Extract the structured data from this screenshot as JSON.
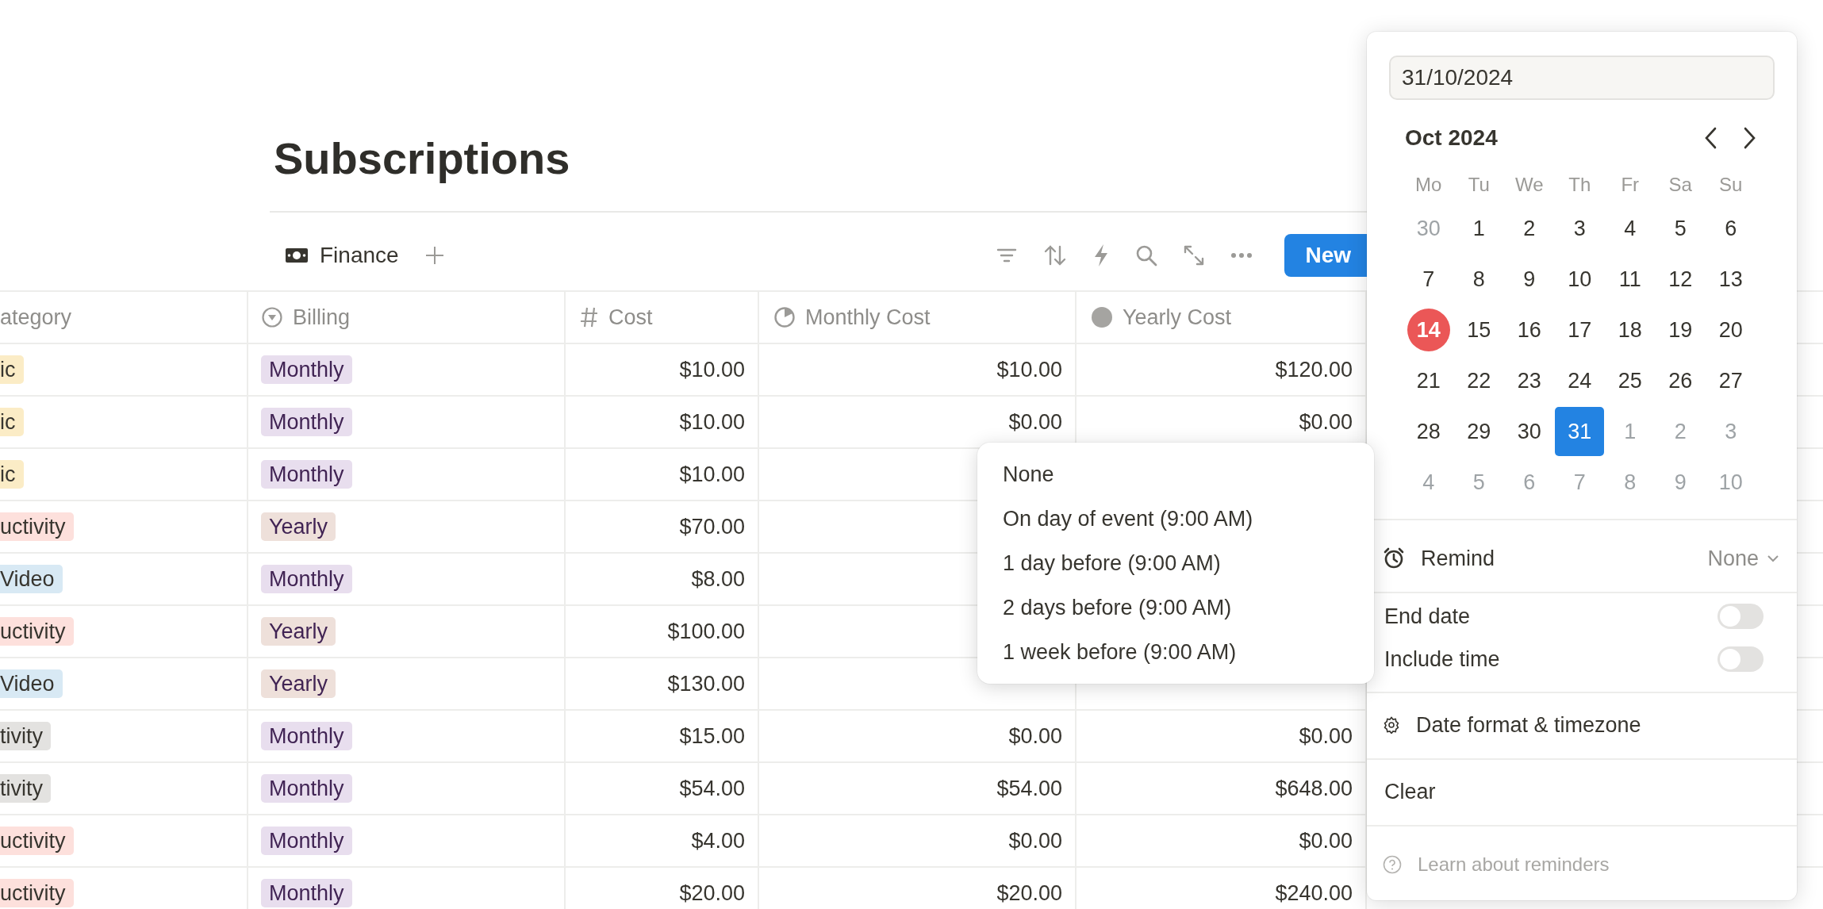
{
  "page": {
    "title": "Subscriptions"
  },
  "view_tabs": [
    {
      "label": "Finance",
      "selected": true
    }
  ],
  "toolbar": {
    "new_button": "New"
  },
  "table": {
    "columns": [
      {
        "label": "ategory",
        "kind": "none"
      },
      {
        "label": "Billing",
        "kind": "select"
      },
      {
        "label": "Cost",
        "kind": "number"
      },
      {
        "label": "Monthly Cost",
        "kind": "formula"
      },
      {
        "label": "Yearly Cost",
        "kind": "rollup"
      }
    ],
    "rows": [
      {
        "category": {
          "label": "ic",
          "color": "#fbecc6"
        },
        "billing": {
          "label": "Monthly",
          "color": "#e8deee"
        },
        "cost": "$10.00",
        "monthly_cost": "$10.00",
        "yearly_cost": "$120.00"
      },
      {
        "category": {
          "label": "ic",
          "color": "#fbecc6"
        },
        "billing": {
          "label": "Monthly",
          "color": "#e8deee"
        },
        "cost": "$10.00",
        "monthly_cost": "$0.00",
        "yearly_cost": "$0.00"
      },
      {
        "category": {
          "label": "ic",
          "color": "#fbecc6"
        },
        "billing": {
          "label": "Monthly",
          "color": "#e8deee"
        },
        "cost": "$10.00"
      },
      {
        "category": {
          "label": "uctivity",
          "color": "#fde0dc"
        },
        "billing": {
          "label": "Yearly",
          "color": "#eee0da"
        },
        "cost": "$70.00"
      },
      {
        "category": {
          "label": "Video",
          "color": "#d8e9f4"
        },
        "billing": {
          "label": "Monthly",
          "color": "#e8deee"
        },
        "cost": "$8.00"
      },
      {
        "category": {
          "label": "uctivity",
          "color": "#fde0dc"
        },
        "billing": {
          "label": "Yearly",
          "color": "#eee0da"
        },
        "cost": "$100.00"
      },
      {
        "category": {
          "label": "Video",
          "color": "#d8e9f4"
        },
        "billing": {
          "label": "Yearly",
          "color": "#eee0da"
        },
        "cost": "$130.00"
      },
      {
        "category": {
          "label": "tivity",
          "color": "#e3e2e0"
        },
        "billing": {
          "label": "Monthly",
          "color": "#e8deee"
        },
        "cost": "$15.00",
        "monthly_cost": "$0.00",
        "yearly_cost": "$0.00"
      },
      {
        "category": {
          "label": "tivity",
          "color": "#e3e2e0"
        },
        "billing": {
          "label": "Monthly",
          "color": "#e8deee"
        },
        "cost": "$54.00",
        "monthly_cost": "$54.00",
        "yearly_cost": "$648.00"
      },
      {
        "category": {
          "label": "uctivity",
          "color": "#fde0dc"
        },
        "billing": {
          "label": "Monthly",
          "color": "#e8deee"
        },
        "cost": "$4.00",
        "monthly_cost": "$0.00",
        "yearly_cost": "$0.00"
      },
      {
        "category": {
          "label": "uctivity",
          "color": "#fde0dc"
        },
        "billing": {
          "label": "Monthly",
          "color": "#e8deee"
        },
        "cost": "$20.00",
        "monthly_cost": "$20.00",
        "yearly_cost": "$240.00"
      }
    ]
  },
  "reminder_menu": {
    "options": [
      "None",
      "On day of event (9:00 AM)",
      "1 day before (9:00 AM)",
      "2 days before (9:00 AM)",
      "1 week before (9:00 AM)"
    ]
  },
  "date_picker": {
    "date_field": "31/10/2024",
    "month_label": "Oct 2024",
    "weekdays": [
      "Mo",
      "Tu",
      "We",
      "Th",
      "Fr",
      "Sa",
      "Su"
    ],
    "days": [
      {
        "label": "30",
        "in_month": false,
        "today": false,
        "selected": false
      },
      {
        "label": "1",
        "in_month": true,
        "today": false,
        "selected": false
      },
      {
        "label": "2",
        "in_month": true,
        "today": false,
        "selected": false
      },
      {
        "label": "3",
        "in_month": true,
        "today": false,
        "selected": false
      },
      {
        "label": "4",
        "in_month": true,
        "today": false,
        "selected": false
      },
      {
        "label": "5",
        "in_month": true,
        "today": false,
        "selected": false
      },
      {
        "label": "6",
        "in_month": true,
        "today": false,
        "selected": false
      },
      {
        "label": "7",
        "in_month": true,
        "today": false,
        "selected": false
      },
      {
        "label": "8",
        "in_month": true,
        "today": false,
        "selected": false
      },
      {
        "label": "9",
        "in_month": true,
        "today": false,
        "selected": false
      },
      {
        "label": "10",
        "in_month": true,
        "today": false,
        "selected": false
      },
      {
        "label": "11",
        "in_month": true,
        "today": false,
        "selected": false
      },
      {
        "label": "12",
        "in_month": true,
        "today": false,
        "selected": false
      },
      {
        "label": "13",
        "in_month": true,
        "today": false,
        "selected": false
      },
      {
        "label": "14",
        "in_month": true,
        "today": true,
        "selected": false
      },
      {
        "label": "15",
        "in_month": true,
        "today": false,
        "selected": false
      },
      {
        "label": "16",
        "in_month": true,
        "today": false,
        "selected": false
      },
      {
        "label": "17",
        "in_month": true,
        "today": false,
        "selected": false
      },
      {
        "label": "18",
        "in_month": true,
        "today": false,
        "selected": false
      },
      {
        "label": "19",
        "in_month": true,
        "today": false,
        "selected": false
      },
      {
        "label": "20",
        "in_month": true,
        "today": false,
        "selected": false
      },
      {
        "label": "21",
        "in_month": true,
        "today": false,
        "selected": false
      },
      {
        "label": "22",
        "in_month": true,
        "today": false,
        "selected": false
      },
      {
        "label": "23",
        "in_month": true,
        "today": false,
        "selected": false
      },
      {
        "label": "24",
        "in_month": true,
        "today": false,
        "selected": false
      },
      {
        "label": "25",
        "in_month": true,
        "today": false,
        "selected": false
      },
      {
        "label": "26",
        "in_month": true,
        "today": false,
        "selected": false
      },
      {
        "label": "27",
        "in_month": true,
        "today": false,
        "selected": false
      },
      {
        "label": "28",
        "in_month": true,
        "today": false,
        "selected": false
      },
      {
        "label": "29",
        "in_month": true,
        "today": false,
        "selected": false
      },
      {
        "label": "30",
        "in_month": true,
        "today": false,
        "selected": false
      },
      {
        "label": "31",
        "in_month": true,
        "today": false,
        "selected": true
      },
      {
        "label": "1",
        "in_month": false,
        "today": false,
        "selected": false
      },
      {
        "label": "2",
        "in_month": false,
        "today": false,
        "selected": false
      },
      {
        "label": "3",
        "in_month": false,
        "today": false,
        "selected": false
      },
      {
        "label": "4",
        "in_month": false,
        "today": false,
        "selected": false
      },
      {
        "label": "5",
        "in_month": false,
        "today": false,
        "selected": false
      },
      {
        "label": "6",
        "in_month": false,
        "today": false,
        "selected": false
      },
      {
        "label": "7",
        "in_month": false,
        "today": false,
        "selected": false
      },
      {
        "label": "8",
        "in_month": false,
        "today": false,
        "selected": false
      },
      {
        "label": "9",
        "in_month": false,
        "today": false,
        "selected": false
      },
      {
        "label": "10",
        "in_month": false,
        "today": false,
        "selected": false
      }
    ],
    "remind": {
      "label": "Remind",
      "value": "None"
    },
    "toggles": [
      {
        "label": "End date",
        "on": false
      },
      {
        "label": "Include time",
        "on": false
      }
    ],
    "format_link": "Date format & timezone",
    "clear": "Clear",
    "help_link": "Learn about reminders"
  }
}
